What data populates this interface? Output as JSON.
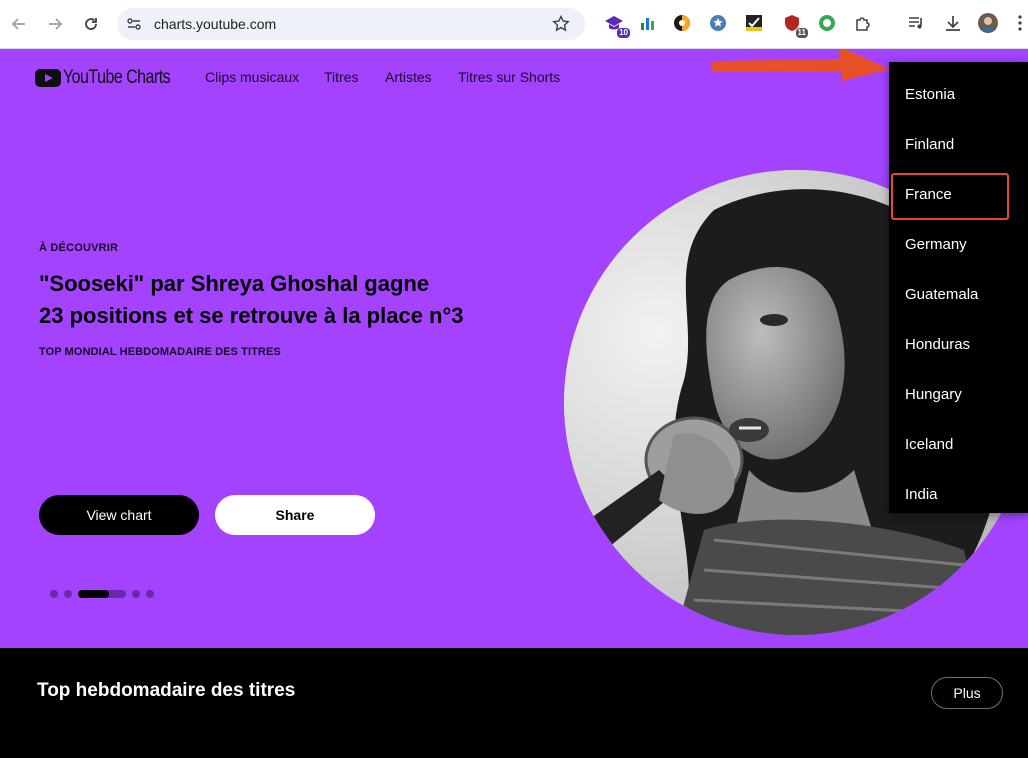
{
  "browser": {
    "url": "charts.youtube.com",
    "extensions": [
      {
        "icon": "graduation-cap-icon",
        "badge": "10",
        "badge_color": "#5b2bb8"
      },
      {
        "icon": "bar-chart-icon",
        "badge": ""
      },
      {
        "icon": "half-circle-icon",
        "badge": ""
      },
      {
        "icon": "star-badge-icon",
        "badge": ""
      },
      {
        "icon": "checkmark-box-icon",
        "badge": ""
      },
      {
        "icon": "shield-icon",
        "badge": "11",
        "badge_color": "#555555"
      },
      {
        "icon": "ring-icon",
        "badge": ""
      },
      {
        "icon": "puzzle-icon",
        "badge": ""
      }
    ]
  },
  "site": {
    "logo_text": "YouTube Charts",
    "nav": [
      "Clips musicaux",
      "Titres",
      "Artistes",
      "Titres sur Shorts"
    ],
    "accent_color": "#a342ff"
  },
  "hero": {
    "eyebrow": "À DÉCOUVRIR",
    "headline_line1": "\"Sooseki\" par Shreya Ghoshal gagne",
    "headline_line2": "23 positions et se retrouve à la place n°3",
    "subline": "TOP MONDIAL HEBDOMADAIRE DES TITRES",
    "view_button": "View chart",
    "share_button": "Share",
    "carousel": {
      "total_dots": 5,
      "active_index": 2,
      "progress": 0.65
    }
  },
  "section": {
    "title": "Top hebdomadaire des titres",
    "more_button": "Plus"
  },
  "country_dropdown": {
    "items": [
      "Estonia",
      "Finland",
      "France",
      "Germany",
      "Guatemala",
      "Honduras",
      "Hungary",
      "Iceland",
      "India"
    ],
    "highlighted": "France",
    "highlight_color": "#e64a2e"
  }
}
